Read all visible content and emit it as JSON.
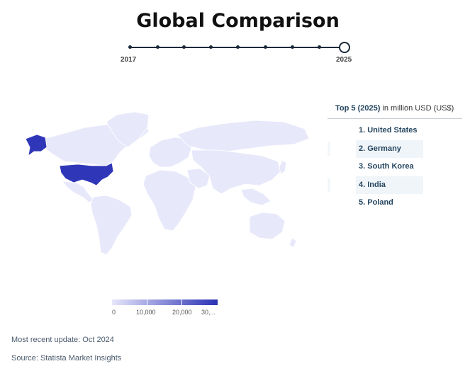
{
  "title": "Global Comparison",
  "timeline": {
    "start_label": "2017",
    "end_label": "2025",
    "points": 9,
    "selected": "2025"
  },
  "top5": {
    "heading": "Top 5 (2025)",
    "unit": "in million USD (US$)",
    "items": [
      "1. United States",
      "2. Germany",
      "3. South Korea",
      "4. India",
      "5. Poland"
    ]
  },
  "legend": {
    "labels": [
      "0",
      "10,000",
      "20,000",
      "30,..."
    ],
    "color_low": "#e6e6fb",
    "color_high": "#2a31b4"
  },
  "footer": {
    "update": "Most recent update: Oct 2024",
    "source": "Source: Statista Market Insights"
  },
  "colors": {
    "highlight": "#2f37b8",
    "land": "#e8e8fb",
    "text_dark": "#24455f"
  }
}
